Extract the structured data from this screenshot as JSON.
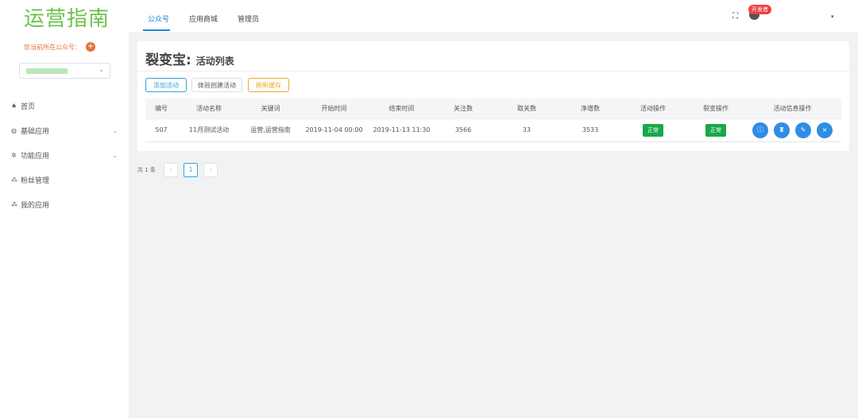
{
  "sidebar": {
    "logo": "运营指南",
    "current_label": "您当前所在公众号：",
    "add_symbol": "+",
    "select_chevron": "⌄",
    "nav": [
      {
        "label": "首页",
        "icon": "home-icon",
        "glyph": "♠"
      },
      {
        "label": "基础应用",
        "icon": "globe-icon",
        "glyph": "◍",
        "chevron": "⌄"
      },
      {
        "label": "功能应用",
        "icon": "gear-icon",
        "glyph": "✲",
        "chevron": "⌄"
      },
      {
        "label": "粉丝管理",
        "icon": "users-icon",
        "glyph": "⁂"
      },
      {
        "label": "我的应用",
        "icon": "apps-icon",
        "glyph": "⁂"
      }
    ]
  },
  "topbar": {
    "tabs": [
      "公众号",
      "应用商城",
      "管理员"
    ],
    "active_tab": 0,
    "fullscreen_glyph": "⛶",
    "developer_badge": "开发者",
    "user_chevron": "▾"
  },
  "page": {
    "title_main": "裂变宝:",
    "title_sub": "活动列表",
    "buttons": {
      "add": "添加活动",
      "experience": "体验创建活动",
      "clear_cache": "刷新缓存"
    }
  },
  "table": {
    "headers": [
      "编号",
      "活动名称",
      "关键词",
      "开始时间",
      "结束时间",
      "关注数",
      "取关数",
      "净增数",
      "活动操作",
      "裂变操作",
      "活动信息操作"
    ],
    "rows": [
      {
        "id": "507",
        "name": "11月测试活动",
        "keyword": "运营,运营指南",
        "start": "2019-11-04 00:00",
        "end": "2019-11-13 11:30",
        "follow": "3566",
        "unfollow": "33",
        "net": "3533",
        "activity_status": "正常",
        "fission_status": "正常",
        "ops": [
          "ⓘ",
          "♜",
          "✎",
          "×"
        ]
      }
    ]
  },
  "pagination": {
    "total": "共 1 条",
    "prev": "‹",
    "page": "1",
    "next": "›"
  },
  "colors": {
    "brand_green": "#6cc24a",
    "accent_blue": "#1b8ad6",
    "status_green": "#18a84a",
    "warn_orange": "#f0a830",
    "badge_red": "#f04040"
  }
}
